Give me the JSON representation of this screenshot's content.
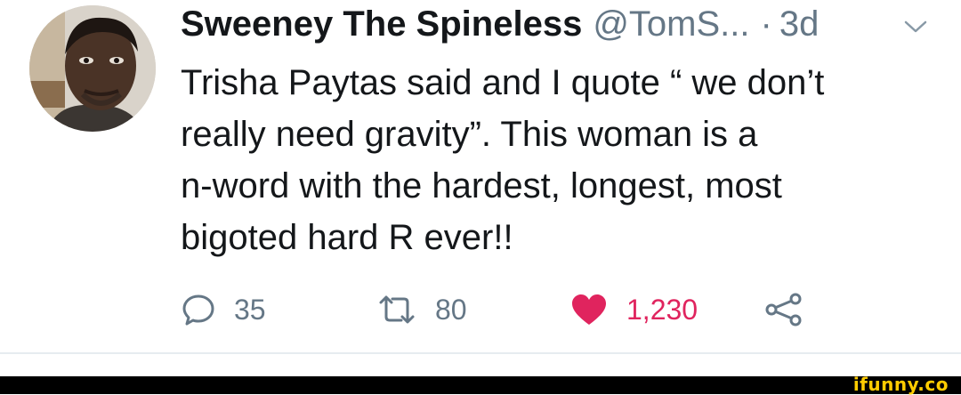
{
  "tweet": {
    "display_name": "Sweeney The Spineless",
    "handle": "@TomS...",
    "separator": "·",
    "time": "3d",
    "text": "Trisha Paytas said and I quote “ we don’t\nreally need gravity”. This woman is a\nn-word with the hardest, longest, most\nbigoted hard R ever!!"
  },
  "actions": {
    "replies": "35",
    "retweets": "80",
    "likes": "1,230"
  },
  "icons": {
    "menu": "chevron-down-icon",
    "reply": "speech-bubble-icon",
    "retweet": "retweet-icon",
    "like": "heart-icon",
    "share": "share-icon"
  },
  "colors": {
    "text": "#14171a",
    "muted": "#657786",
    "like": "#e0245e",
    "watermark": "#ffcc00"
  },
  "watermark": "ifunny.co"
}
